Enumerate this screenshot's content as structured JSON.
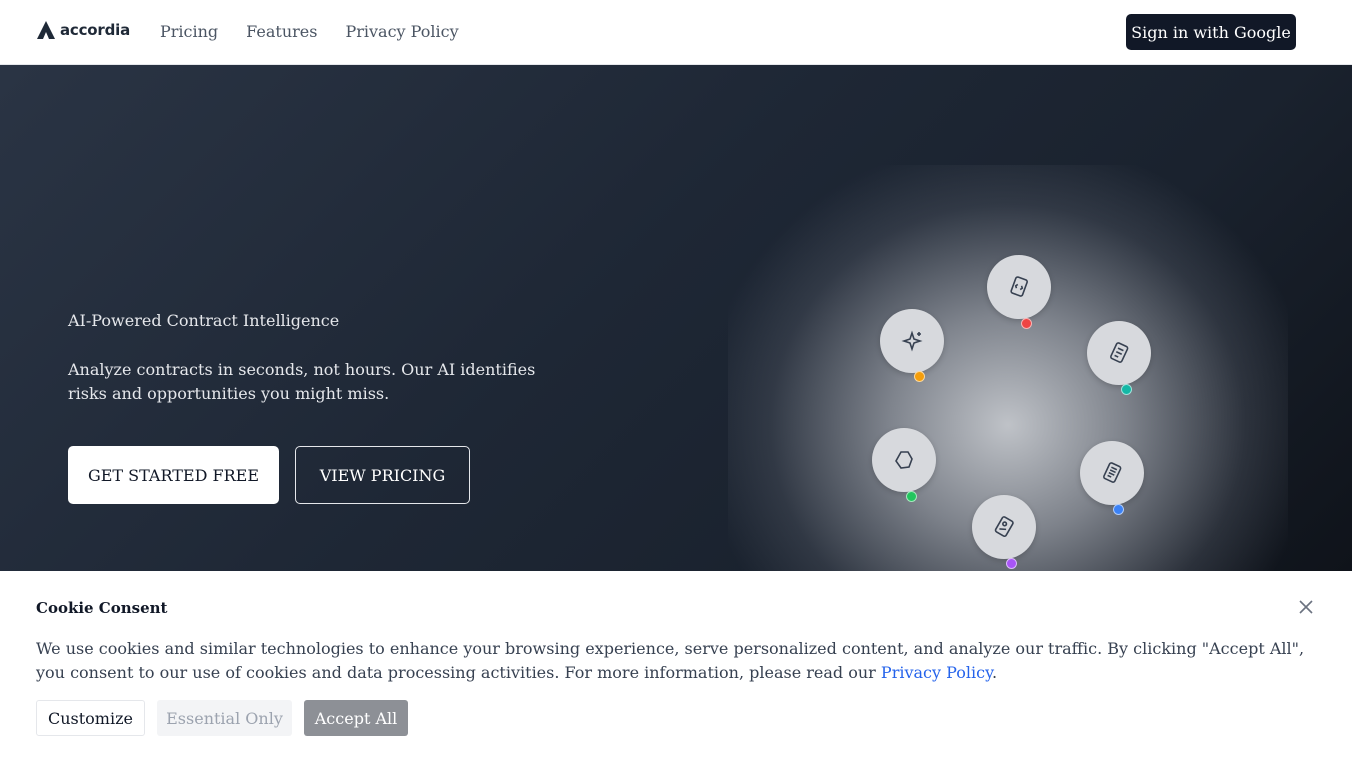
{
  "header": {
    "logo_text": "accordia",
    "nav": [
      {
        "label": "Pricing"
      },
      {
        "label": "Features"
      },
      {
        "label": "Privacy Policy"
      }
    ],
    "signin_label": "Sign in with Google"
  },
  "hero": {
    "eyebrow": "AI-Powered Contract Intelligence",
    "subtitle": "Analyze contracts in seconds, not hours. Our AI identifies risks and opportunities you might miss.",
    "primary_cta": "GET STARTED FREE",
    "secondary_cta": "VIEW PRICING",
    "orbit_nodes": [
      {
        "icon": "document-code-icon",
        "dot_color": "#ef4444"
      },
      {
        "icon": "document-table-icon",
        "dot_color": "#14b8a6"
      },
      {
        "icon": "document-lines-icon",
        "dot_color": "#3b82f6"
      },
      {
        "icon": "document-signature-icon",
        "dot_color": "#a855f7"
      },
      {
        "icon": "hexagon-icon",
        "dot_color": "#22c55e"
      },
      {
        "icon": "sparkle-icon",
        "dot_color": "#f59e0b"
      }
    ]
  },
  "cookie": {
    "title": "Cookie Consent",
    "text_before": "We use cookies and similar technologies to enhance your browsing experience, serve personalized content, and analyze our traffic. By clicking \"Accept All\", you consent to our use of cookies and data processing activities. For more information, please read our ",
    "link_label": "Privacy Policy",
    "text_after": ".",
    "customize_label": "Customize",
    "essential_label": "Essential Only",
    "accept_label": "Accept All"
  },
  "colors": {
    "brand_dark": "#111827",
    "link": "#2563eb",
    "accept_button": "#8d9096"
  }
}
